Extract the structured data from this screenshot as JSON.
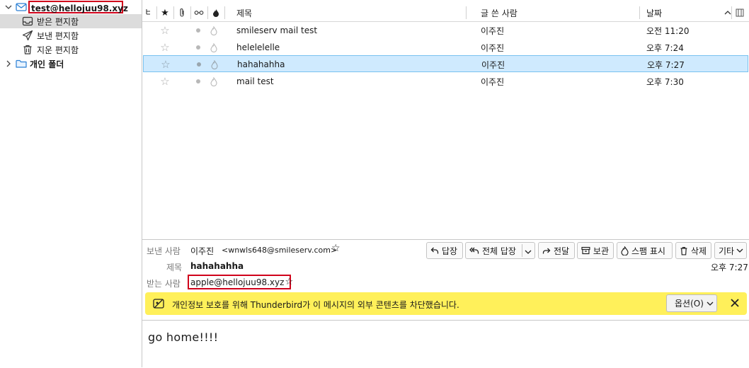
{
  "sidebar": {
    "account": "test@hellojuu98.xyz",
    "folders": [
      {
        "label": "받은 편지함",
        "icon": "inbox-icon"
      },
      {
        "label": "보낸 편지함",
        "icon": "sent-icon"
      },
      {
        "label": "지운 편지함",
        "icon": "trash-icon"
      }
    ],
    "local_folders": "개인 폴더"
  },
  "list": {
    "columns": {
      "subject": "제목",
      "sender": "글 쓴 사람",
      "date": "날짜"
    },
    "rows": [
      {
        "subject": "smileserv mail test",
        "sender": "이주진",
        "date": "오전 11:20"
      },
      {
        "subject": "helelelelle",
        "sender": "이주진",
        "date": "오후 7:24"
      },
      {
        "subject": "hahahahha",
        "sender": "이주진",
        "date": "오후 7:27",
        "selected": true
      },
      {
        "subject": "mail test",
        "sender": "이주진",
        "date": "오후 7:30"
      }
    ]
  },
  "preview": {
    "from_label": "보낸 사람",
    "from_name": "이주진",
    "from_email": "<wnwls648@smileserv.com>",
    "subject_label": "제목",
    "subject": "hahahahha",
    "date": "오후 7:27",
    "to_label": "받는 사람",
    "to": "apple@hellojuu98.xyz",
    "buttons": {
      "reply": "답장",
      "reply_all": "전체 답장",
      "forward": "전달",
      "archive": "보관",
      "spam": "스팸 표시",
      "delete": "삭제",
      "more": "기타"
    },
    "notice": "개인정보 보호를 위해 Thunderbird가 이 메시지의 외부 콘텐츠를 차단했습니다.",
    "notice_options": "옵션(O)",
    "body": "go home!!!!"
  },
  "colors": {
    "selection": "#cfeafe",
    "highlight_box": "#d0021b",
    "notice_bg": "#fff05a"
  }
}
